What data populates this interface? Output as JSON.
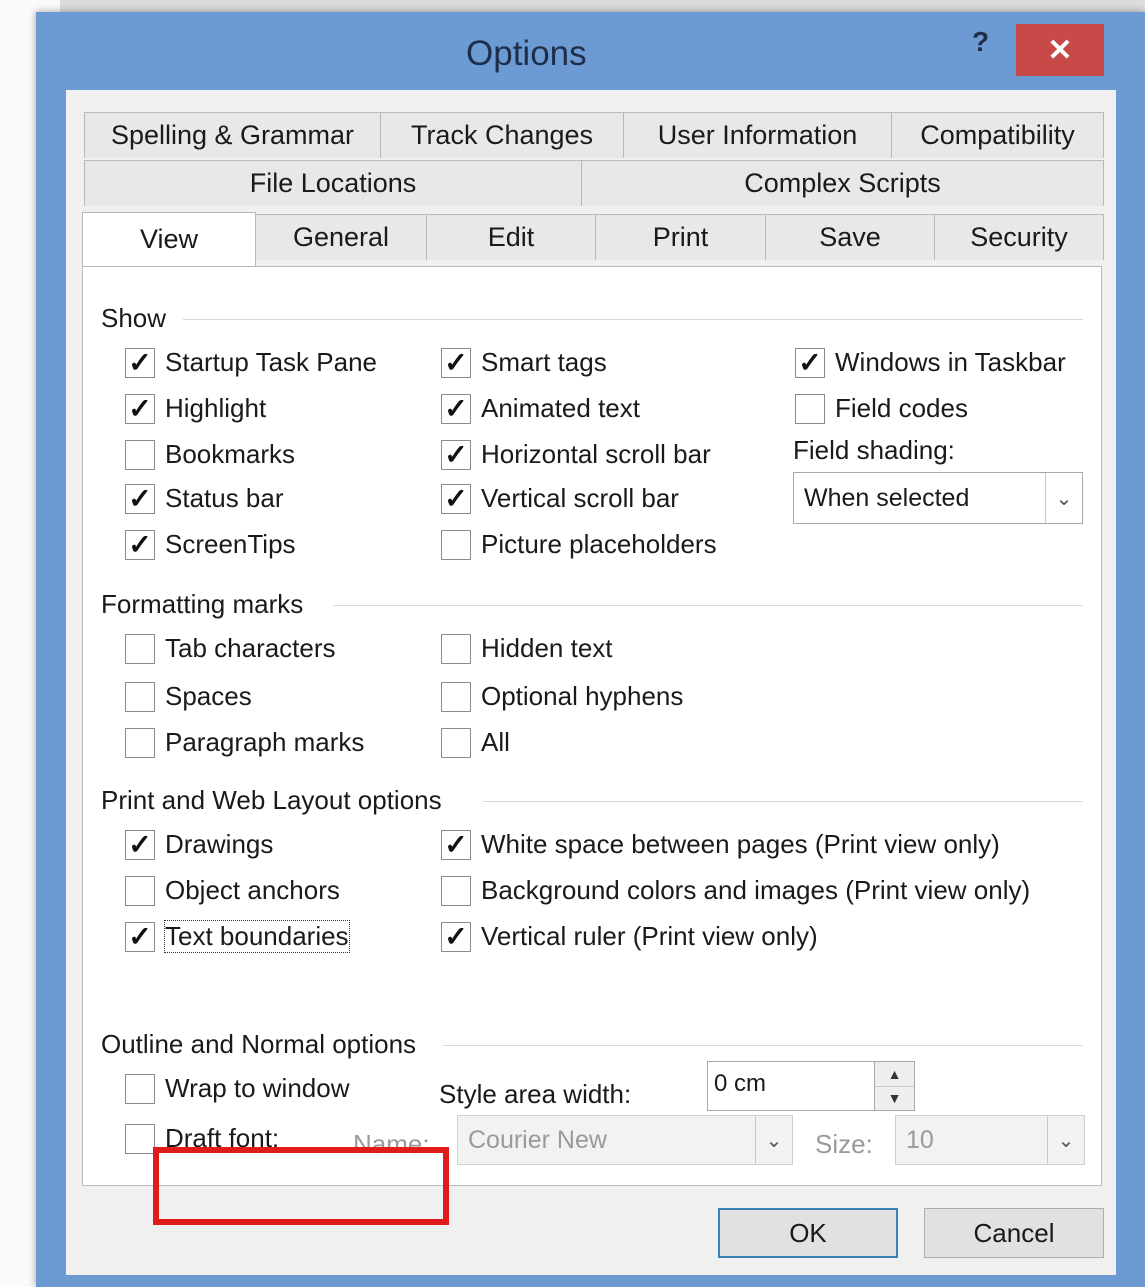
{
  "window": {
    "title": "Options",
    "help_label": "?",
    "close_label": "✕"
  },
  "tabs": {
    "row1": [
      "Spelling & Grammar",
      "Track Changes",
      "User Information",
      "Compatibility"
    ],
    "row2": [
      "File Locations",
      "Complex Scripts"
    ],
    "row3": [
      "View",
      "General",
      "Edit",
      "Print",
      "Save",
      "Security"
    ],
    "active": "View"
  },
  "show": {
    "heading": "Show",
    "col1": [
      {
        "label": "Startup Task Pane",
        "checked": true
      },
      {
        "label": "Highlight",
        "checked": true
      },
      {
        "label": "Bookmarks",
        "checked": false
      },
      {
        "label": "Status bar",
        "checked": true
      },
      {
        "label": "ScreenTips",
        "checked": true
      }
    ],
    "col2": [
      {
        "label": "Smart tags",
        "checked": true
      },
      {
        "label": "Animated text",
        "checked": true
      },
      {
        "label": "Horizontal scroll bar",
        "checked": true
      },
      {
        "label": "Vertical scroll bar",
        "checked": true
      },
      {
        "label": "Picture placeholders",
        "checked": false
      }
    ],
    "col3": [
      {
        "label": "Windows in Taskbar",
        "checked": true
      },
      {
        "label": "Field codes",
        "checked": false
      }
    ],
    "field_shading_label": "Field shading:",
    "field_shading_value": "When selected"
  },
  "formatting": {
    "heading": "Formatting marks",
    "col1": [
      {
        "label": "Tab characters",
        "checked": false
      },
      {
        "label": "Spaces",
        "checked": false
      },
      {
        "label": "Paragraph marks",
        "checked": false
      }
    ],
    "col2": [
      {
        "label": "Hidden text",
        "checked": false
      },
      {
        "label": "Optional hyphens",
        "checked": false
      },
      {
        "label": "All",
        "checked": false
      }
    ]
  },
  "print_layout": {
    "heading": "Print and Web Layout options",
    "col1": [
      {
        "label": "Drawings",
        "checked": true
      },
      {
        "label": "Object anchors",
        "checked": false
      },
      {
        "label": "Text boundaries",
        "checked": true
      }
    ],
    "col2": [
      {
        "label": "White space between pages (Print view only)",
        "checked": true
      },
      {
        "label": "Background colors and images (Print view only)",
        "checked": false
      },
      {
        "label": "Vertical ruler (Print view only)",
        "checked": true
      }
    ]
  },
  "outline": {
    "heading": "Outline and Normal options",
    "wrap_label": "Wrap to window",
    "wrap_checked": false,
    "draft_label": "Draft font:",
    "draft_checked": false,
    "style_area_label": "Style area width:",
    "style_area_value": "0 cm",
    "name_label": "Name:",
    "name_value": "Courier New",
    "size_label": "Size:",
    "size_value": "10"
  },
  "buttons": {
    "ok": "OK",
    "cancel": "Cancel"
  },
  "glyphs": {
    "check": "✓",
    "down": "⌄",
    "up": "▲",
    "spin_down": "▼"
  }
}
